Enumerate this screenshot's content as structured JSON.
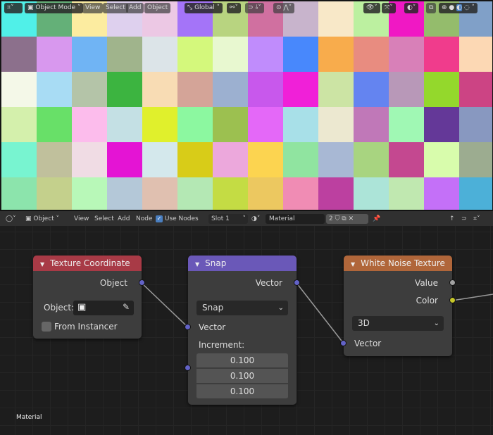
{
  "viewport": {
    "header": {
      "editor_type_icon": "viewport-editor-icon",
      "mode": "Object Mode",
      "menus": [
        "View",
        "Select",
        "Add",
        "Object"
      ],
      "orientation": "Global"
    },
    "cell_colors": [
      [
        "#50f0e8",
        "#64b078",
        "#fcecA0",
        "#ded0ee",
        "#ecc8e4",
        "#a474f8",
        "#b8d480",
        "#d070a0",
        "#c8b4cc",
        "#f8e8c8",
        "#bcf0a0",
        "#f018c4",
        "#94bc6c",
        "#80a0c8"
      ],
      [
        "#8c708c",
        "#d898ee",
        "#70b4f4",
        "#a0b48c",
        "#dce4e8",
        "#d4f87c",
        "#e8f8d0",
        "#c08cfc",
        "#4888fc",
        "#f8ac4c",
        "#e88c80",
        "#d880b8",
        "#f03c8c",
        "#fcd8b4"
      ],
      [
        "#f4f8e8",
        "#a8dcf4",
        "#b4c4a8",
        "#3cb440",
        "#f8dcb4",
        "#d4a498",
        "#9cb0d0",
        "#c858ec",
        "#f020d8",
        "#cce4a4",
        "#6484f0",
        "#b898b8",
        "#94d82c",
        "#cc4484"
      ],
      [
        "#d4f0ac",
        "#68e068",
        "#fcbcec",
        "#c4e0e4",
        "#e0f02c",
        "#8cf8a0",
        "#9cc050",
        "#e468f8",
        "#a8e0e8",
        "#ece8d0",
        "#c078b8",
        "#a0f8b4",
        "#643898",
        "#8898c0"
      ],
      [
        "#78f4d0",
        "#c0c09c",
        "#f0dce4",
        "#e414d4",
        "#d4e8ec",
        "#d8cc18",
        "#eca8dc",
        "#fcd450",
        "#90e4a0",
        "#a8b8d4",
        "#a8d480",
        "#c44890",
        "#d8fcac",
        "#9cac90"
      ],
      [
        "#8ce4ac",
        "#c4d08c",
        "#b8f8b8",
        "#b4c8d8",
        "#e0c0b0",
        "#b4e8b4",
        "#c4dc44",
        "#ecc860",
        "#f08cb4",
        "#bc40a0",
        "#ace4d8",
        "#c0e8b0",
        "#c470f8",
        "#4cb0d8"
      ]
    ]
  },
  "node_editor": {
    "header": {
      "type": "Object",
      "menus": [
        "View",
        "Select",
        "Add",
        "Node"
      ],
      "use_nodes_label": "Use Nodes",
      "use_nodes": true,
      "slot": "Slot 1",
      "material": "Material",
      "users": "2"
    },
    "footer_label": "Material",
    "nodes": {
      "texcoord": {
        "title": "Texture Coordinate",
        "color": "#a83a46",
        "output": "Object",
        "object_label": "Object:",
        "from_instancer": "From Instancer"
      },
      "snap": {
        "title": "Snap",
        "color": "#6a58b8",
        "output": "Vector",
        "operation": "Snap",
        "input_vector": "Vector",
        "increment_label": "Increment:",
        "increment": [
          "0.100",
          "0.100",
          "0.100"
        ]
      },
      "noise": {
        "title": "White Noise Texture",
        "color": "#b0663a",
        "outputs": [
          "Value",
          "Color"
        ],
        "dimensions": "3D",
        "input_vector": "Vector"
      }
    }
  }
}
